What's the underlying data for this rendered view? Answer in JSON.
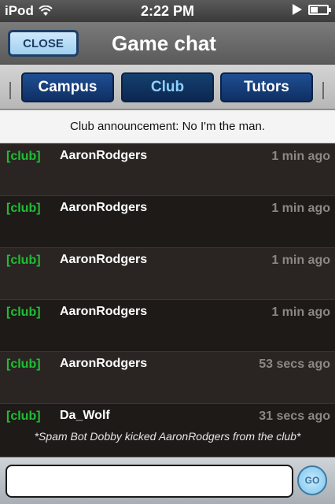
{
  "status_bar": {
    "carrier": "iPod",
    "time": "2:22 PM"
  },
  "header": {
    "close_label": "CLOSE",
    "title": "Game chat"
  },
  "tabs": [
    {
      "label": "Campus",
      "active": false
    },
    {
      "label": "Club",
      "active": true
    },
    {
      "label": "Tutors",
      "active": false
    }
  ],
  "announcement": "Club  announcement: No I'm the man.",
  "messages": [
    {
      "tag": "[club]",
      "user": "AaronRodgers",
      "ago": "1 min ago",
      "text": ""
    },
    {
      "tag": "[club]",
      "user": "AaronRodgers",
      "ago": "1 min ago",
      "text": ""
    },
    {
      "tag": "[club]",
      "user": "AaronRodgers",
      "ago": "1 min ago",
      "text": ""
    },
    {
      "tag": "[club]",
      "user": "AaronRodgers",
      "ago": "1 min ago",
      "text": ""
    },
    {
      "tag": "[club]",
      "user": "AaronRodgers",
      "ago": "53 secs ago",
      "text": ""
    },
    {
      "tag": "[club]",
      "user": "Da_Wolf",
      "ago": "31 secs ago",
      "text": "*Spam Bot Dobby kicked AaronRodgers from the club*"
    }
  ],
  "input": {
    "value": "",
    "placeholder": ""
  },
  "go_label": "GO",
  "colors": {
    "club_tag": "#1fbf34",
    "header_bg": "#6b6b6b",
    "tab_bg": "#1e4f92"
  }
}
